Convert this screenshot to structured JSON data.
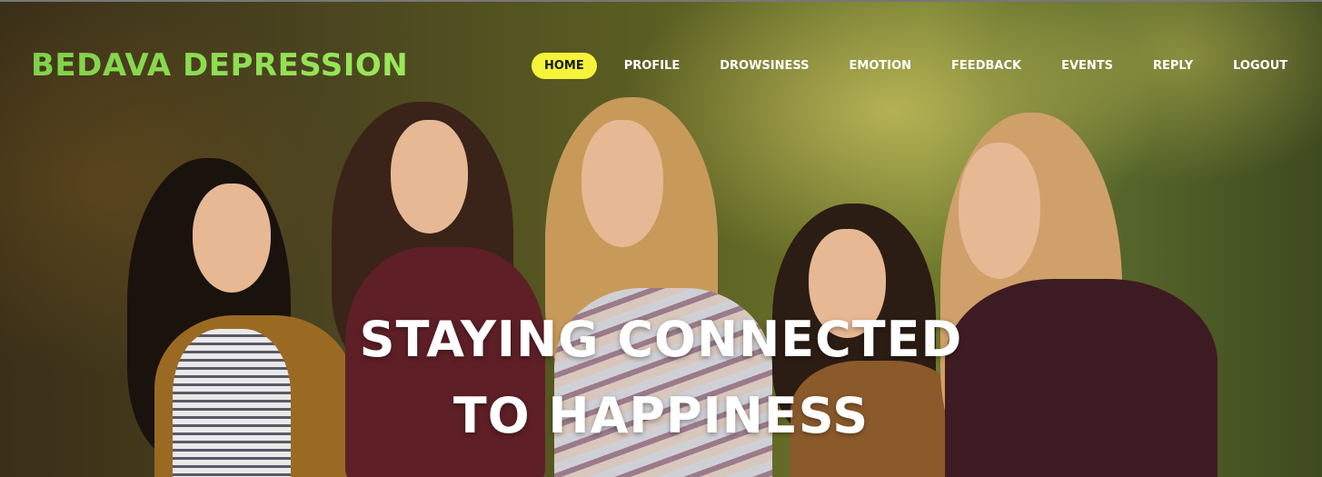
{
  "brand": {
    "title": "BEDAVA DEPRESSION"
  },
  "nav": {
    "items": [
      {
        "label": "HOME",
        "active": true
      },
      {
        "label": "PROFILE",
        "active": false
      },
      {
        "label": "DROWSINESS",
        "active": false
      },
      {
        "label": "EMOTION",
        "active": false
      },
      {
        "label": "FEEDBACK",
        "active": false
      },
      {
        "label": "EVENTS",
        "active": false
      },
      {
        "label": "REPLY",
        "active": false
      },
      {
        "label": "LOGOUT",
        "active": false
      }
    ]
  },
  "hero": {
    "headline_line1": "STAYING CONNECTED",
    "headline_line2": "TO HAPPINESS"
  },
  "colors": {
    "active_nav_bg": "#f5f33a",
    "brand_green": "#8be04e",
    "text_white": "#ffffff"
  }
}
